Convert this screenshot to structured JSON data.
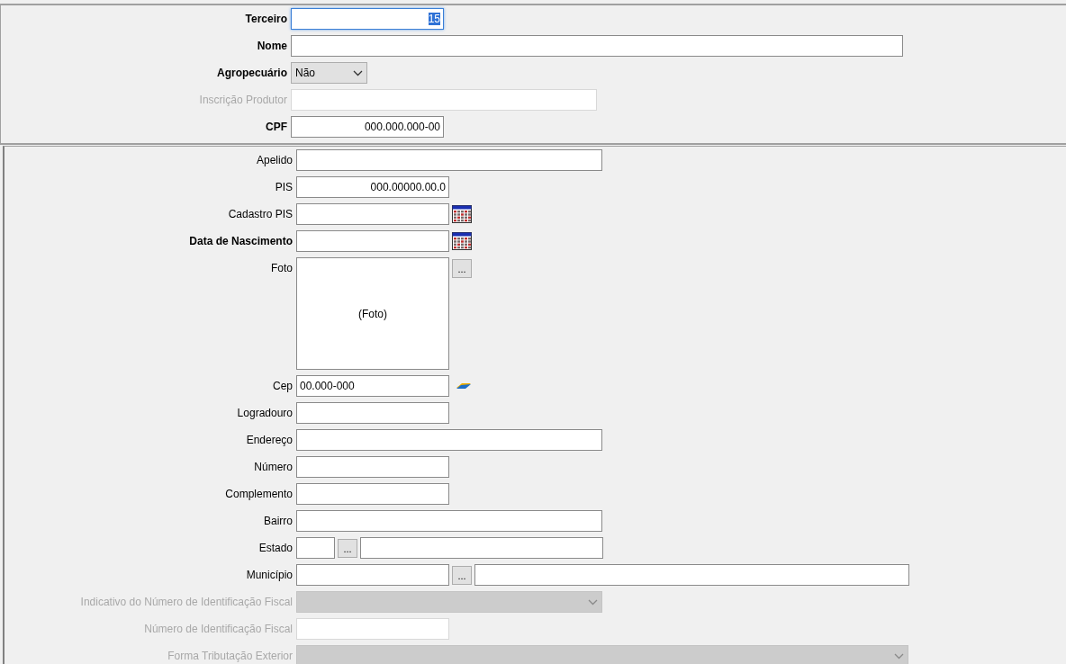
{
  "header_fields": [
    {
      "kind": "text",
      "label": "Terceiro",
      "bold": true,
      "disabled": false,
      "value": "15",
      "focused": true
    },
    {
      "kind": "text",
      "label": "Nome",
      "bold": true,
      "disabled": false,
      "focused": false
    },
    {
      "kind": "select",
      "label": "Agropecuário",
      "bold": true,
      "disabled": false,
      "value": "Não"
    },
    {
      "kind": "text",
      "label": "Inscrição Produtor",
      "bold": false,
      "disabled": true,
      "focused": false
    },
    {
      "kind": "text",
      "label": "CPF",
      "bold": true,
      "disabled": false,
      "value": "000.000.000-00",
      "focused": false
    }
  ],
  "detail_fields": [
    {
      "kind": "text",
      "label": "Apelido",
      "bold": false,
      "disabled": false,
      "focused": false
    },
    {
      "kind": "text",
      "label": "PIS",
      "bold": false,
      "disabled": false,
      "value": "000.00000.00.0",
      "focused": false
    },
    {
      "kind": "date",
      "label": "Cadastro PIS",
      "bold": false,
      "disabled": false
    },
    {
      "kind": "date",
      "label": "Data de Nascimento",
      "bold": true,
      "disabled": false
    },
    {
      "kind": "photo",
      "label": "Foto",
      "bold": false,
      "disabled": false,
      "placeholder": "(Foto)",
      "button": "..."
    },
    {
      "kind": "cep",
      "label": "Cep",
      "bold": false,
      "disabled": false,
      "value": "00.000-000"
    },
    {
      "kind": "text",
      "label": "Logradouro",
      "bold": false,
      "disabled": false,
      "focused": false
    },
    {
      "kind": "text",
      "label": "Endereço",
      "bold": false,
      "disabled": false,
      "focused": false
    },
    {
      "kind": "text",
      "label": "Número",
      "bold": false,
      "disabled": false,
      "focused": false
    },
    {
      "kind": "text",
      "label": "Complemento",
      "bold": false,
      "disabled": false,
      "focused": false
    },
    {
      "kind": "text",
      "label": "Bairro",
      "bold": false,
      "disabled": false,
      "focused": false
    },
    {
      "kind": "lookup",
      "label": "Estado",
      "bold": false,
      "disabled": false,
      "button": "..."
    },
    {
      "kind": "lookup",
      "label": "Município",
      "bold": false,
      "disabled": false,
      "button": "..."
    },
    {
      "kind": "select",
      "label": "Indicativo do Número de Identificação Fiscal",
      "bold": false,
      "disabled": true
    },
    {
      "kind": "text",
      "label": "Número de Identificação Fiscal",
      "bold": false,
      "disabled": true,
      "focused": false
    },
    {
      "kind": "select",
      "label": "Forma Tributação Exterior",
      "bold": false,
      "disabled": true
    }
  ]
}
